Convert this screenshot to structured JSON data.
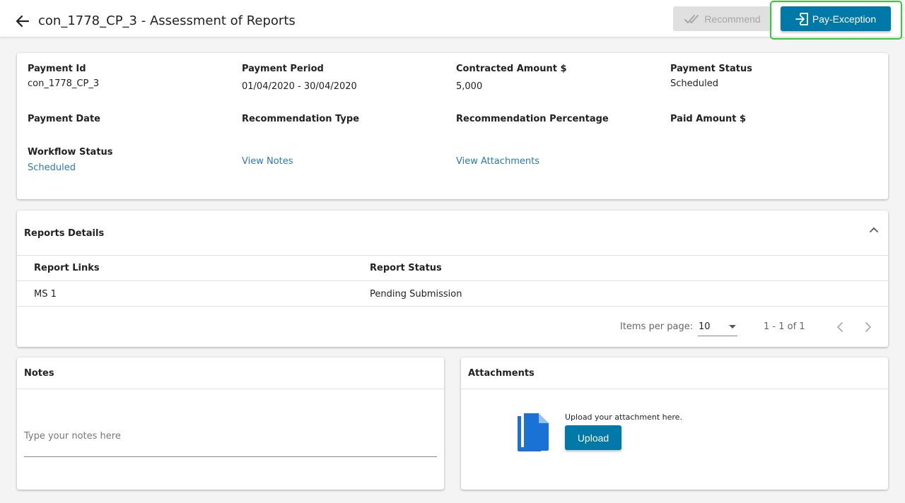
{
  "header": {
    "title": "con_1778_CP_3 - Assessment of Reports",
    "recommend_label": "Recommend",
    "pay_exception_label": "Pay-Exception"
  },
  "info": {
    "payment_id": {
      "label": "Payment Id",
      "value": "con_1778_CP_3"
    },
    "payment_period": {
      "label": "Payment Period",
      "value": "01/04/2020 - 30/04/2020"
    },
    "contracted_amount": {
      "label": "Contracted Amount $",
      "value": "5,000"
    },
    "payment_status": {
      "label": "Payment Status",
      "value": "Scheduled"
    },
    "payment_date": {
      "label": "Payment Date",
      "value": ""
    },
    "recommendation_type": {
      "label": "Recommendation Type",
      "value": ""
    },
    "recommendation_percentage": {
      "label": "Recommendation Percentage",
      "value": ""
    },
    "paid_amount": {
      "label": "Paid Amount $",
      "value": ""
    },
    "workflow_status": {
      "label": "Workflow Status",
      "value": "Scheduled"
    },
    "view_notes": "View Notes",
    "view_attachments": "View Attachments"
  },
  "reports": {
    "title": "Reports Details",
    "columns": [
      "Report Links",
      "Report Status"
    ],
    "rows": [
      {
        "link": "MS 1",
        "status": "Pending Submission"
      }
    ],
    "pager": {
      "items_per_page_label": "Items per page:",
      "items_per_page": "10",
      "range": "1 - 1 of 1"
    }
  },
  "notes": {
    "title": "Notes",
    "placeholder": "Type your notes here"
  },
  "attachments": {
    "title": "Attachments",
    "hint": "Upload your attachment here.",
    "upload_label": "Upload"
  },
  "colors": {
    "primary": "#0078a8",
    "link": "#2a7ab8",
    "highlight_outline": "#33cc33",
    "file_icon": "#1a73d4"
  },
  "icons": {
    "back": "arrow-left-icon",
    "recommend": "double-check-icon",
    "pay_exception": "sign-in-icon",
    "collapse": "chevron-up-icon",
    "pager_prev": "chevron-left-icon",
    "pager_next": "chevron-right-icon",
    "attachment": "file-copy-icon"
  }
}
